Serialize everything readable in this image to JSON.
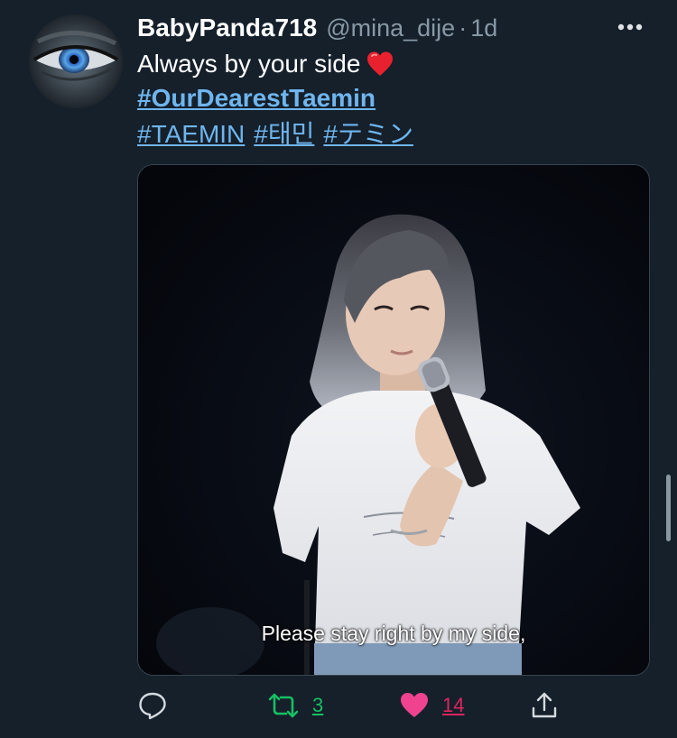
{
  "tweet": {
    "display_name": "BabyPanda718",
    "handle": "@mina_dije",
    "separator": "·",
    "timestamp": "1d",
    "text": "Always by your side",
    "hashtags_line1": [
      "#OurDearestTaemin"
    ],
    "hashtags_line2": [
      "#TAEMIN",
      "#태민",
      "#テミン"
    ],
    "media": {
      "subtitle": "Please stay right by my side,"
    }
  },
  "actions": {
    "reply_icon": "reply-icon",
    "retweet_icon": "retweet-icon",
    "retweet_count": "3",
    "like_icon": "heart-filled-icon",
    "like_count": "14",
    "share_icon": "share-icon",
    "more_icon": "more-horizontal-icon"
  },
  "colors": {
    "background": "#15202b",
    "link": "#6fb5ee",
    "secondary_text": "#8899a6",
    "retweet_green": "#17bf63",
    "like_pink": "#e0245e"
  }
}
